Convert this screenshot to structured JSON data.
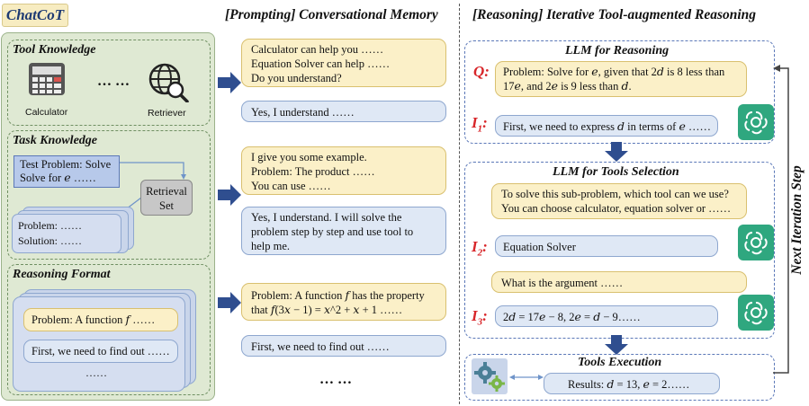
{
  "headers": {
    "chatcot": "ChatCoT",
    "memory_title": "[Prompting] Conversational Memory",
    "reasoning_title": "[Reasoning] Iterative Tool-augmented Reasoning"
  },
  "left": {
    "tool_knowledge": {
      "title": "Tool Knowledge",
      "calculator": "Calculator",
      "ellipsis": "…  …",
      "retriever": "Retriever"
    },
    "task_knowledge": {
      "title": "Task Knowledge",
      "test_line1": "Test Problem: Solve",
      "test_line2": "Solve for 𝑒 ……",
      "retrieval_set_1": "Retrieval",
      "retrieval_set_2": "Set",
      "problem": "Problem:  ……",
      "solution": "Solution:  ……"
    },
    "reasoning_format": {
      "title": "Reasoning Format",
      "problem": "Problem: A function 𝑓  ……",
      "first": "First, we need to find out ……",
      "dots": "……"
    }
  },
  "memory": {
    "b1_l1": "Calculator can help you ……",
    "b1_l2": "Equation Solver can help ……",
    "b1_l3": "Do you understand?",
    "b2": "Yes, I understand ……",
    "b3_l1": "I give you some example.",
    "b3_l2": "Problem: The product ……",
    "b3_l3": "You can use ……",
    "b4_l1": "Yes, I understand. I will solve the",
    "b4_l2": "problem step by step and use tool to",
    "b4_l3": "help me.",
    "b5_l1": "Problem: A function 𝑓 has the property",
    "b5_l2": "that 𝑓(3𝑥 − 1) = 𝑥^2 + 𝑥 + 1  ……",
    "b6": "First, we need to find out ……",
    "more": "…  …"
  },
  "reasoning": {
    "llm_reasoning_title": "LLM for Reasoning",
    "q_label": "Q:",
    "q_l1": "Problem: Solve for 𝑒, given that 2𝑑 is 8 less than",
    "q_l2": "17𝑒, and 2𝑒 is 9 less than 𝑑.",
    "i1_label": "I",
    "i1_sub": "1",
    "i1_text": "First, we need to express 𝑑 in terms of 𝑒 ……",
    "tools_sel_title": "LLM for Tools Selection",
    "ts_l1": "To solve this sub-problem, which tool can we use?",
    "ts_l2": "You can choose calculator, equation solver or ……",
    "i2_label": "I",
    "i2_sub": "2",
    "i2_text": "Equation Solver",
    "arg_text": "What is the argument ……",
    "i3_label": "I",
    "i3_sub": "3",
    "i3_text": "2𝑑 = 17𝑒 − 8, 2𝑒 = 𝑑 − 9……",
    "tools_exec_title": "Tools Execution",
    "results": "Results: 𝑑 = 13, 𝑒 = 2……",
    "next_step": "Next Iteration Step"
  },
  "colors": {
    "arrow_blue": "#2f4e8f",
    "gpt_green": "#2fa77f",
    "label_red": "#d8262a"
  }
}
